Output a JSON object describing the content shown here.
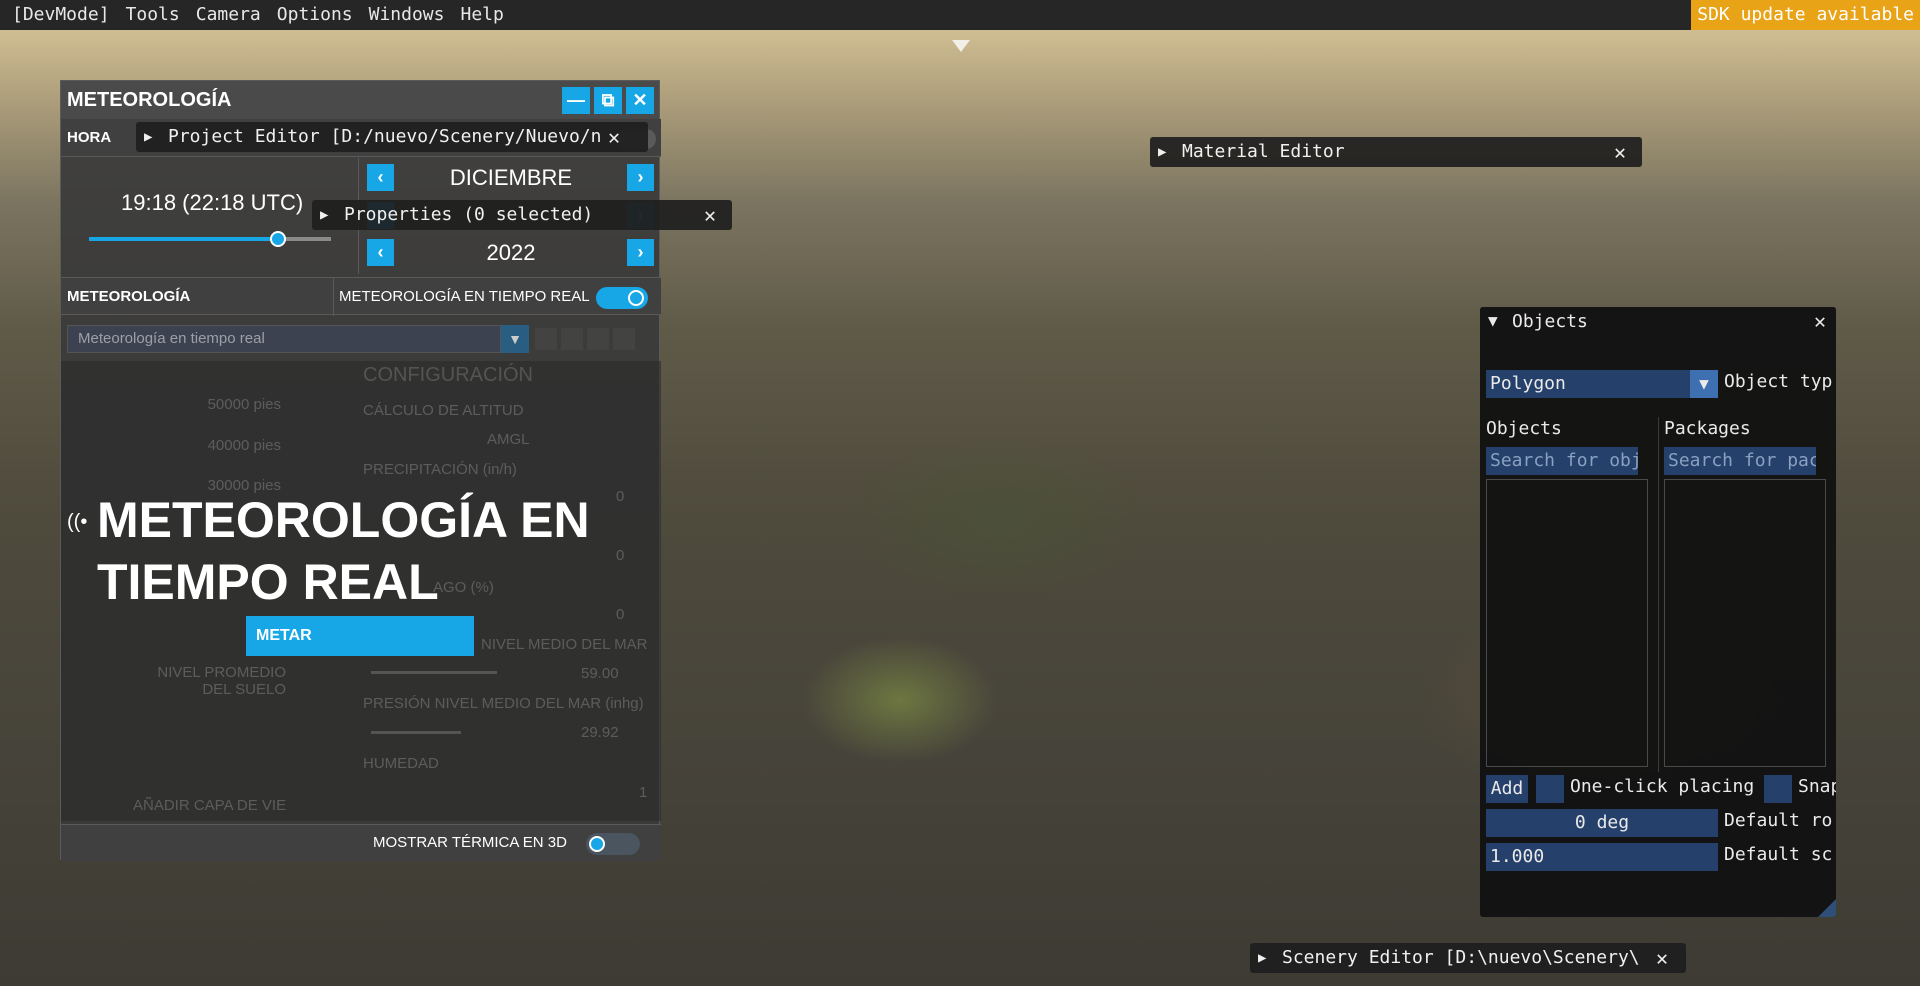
{
  "menubar": {
    "items": [
      "[DevMode]",
      "Tools",
      "Camera",
      "Options",
      "Windows",
      "Help"
    ],
    "sdk_notice": "SDK update available"
  },
  "meteo": {
    "title": "METEOROLOGÍA",
    "hora_label": "HORA",
    "time": "19:18 (22:18 UTC)",
    "time_slider_fraction": 0.78,
    "month": "DICIEMBRE",
    "year": "2022",
    "section_label": "METEOROLOGÍA",
    "live_label": "METEOROLOGÍA EN TIEMPO REAL",
    "preset_value": "Meteorología en tiempo real",
    "overlay_title": "METEOROLOGÍA EN TIEMPO REAL",
    "metar_button": "METAR",
    "bg": {
      "layers": [
        "50000 pies",
        "40000 pies",
        "30000 pies"
      ],
      "config_title": "CONFIGURACIÓN",
      "altitude_calc": "CÁLCULO DE ALTITUD",
      "amgl": "AMGL",
      "precipitation": "PRECIPITACIÓN (in/h)",
      "precip_value": "0",
      "field2_value": "0",
      "ago_label": "AGO (%)",
      "field3_value": "0",
      "sea_level_label": "NIVEL MEDIO DEL MAR",
      "sea_level_value": "59.00",
      "ground_avg_label": "NIVEL PROMEDIO DEL SUELO",
      "pressure_label": "PRESIÓN NIVEL MEDIO DEL MAR (inhg)",
      "pressure_value": "29.92",
      "humidity_label": "HUMEDAD",
      "humidity_value": "1",
      "add_layer_button": "AÑADIR CAPA DE VIE"
    },
    "thermal_label": "MOSTRAR TÉRMICA EN 3D"
  },
  "project_editor": {
    "title": "Project Editor [D:/nuevo/Scenery/Nuevo/n"
  },
  "properties": {
    "title": "Properties (0 selected)"
  },
  "material_editor": {
    "title": "Material Editor"
  },
  "scenery_editor": {
    "title": "Scenery Editor [D:\\nuevo\\Scenery\\"
  },
  "objects": {
    "title": "Objects",
    "type_value": "Polygon",
    "type_label": "Object typ",
    "objects_label": "Objects",
    "packages_label": "Packages",
    "search_objects_placeholder": "Search for obj",
    "search_packages_placeholder": "Search for pac",
    "add_button": "Add",
    "one_click_label": "One-click placing",
    "snap_label": "Snap",
    "rotation_value": "0 deg",
    "rotation_label": "Default ro",
    "scale_value": "1.000",
    "scale_label": "Default sc"
  },
  "colors": {
    "accent": "#17a7e6",
    "sdk": "#e8a317",
    "imgui_frame": "#25406a"
  },
  "icons": [
    "minimize-icon",
    "popout-icon",
    "close-icon",
    "chevron-left-icon",
    "chevron-right-icon",
    "broadcast-icon",
    "triangle-right-icon",
    "triangle-down-icon"
  ]
}
